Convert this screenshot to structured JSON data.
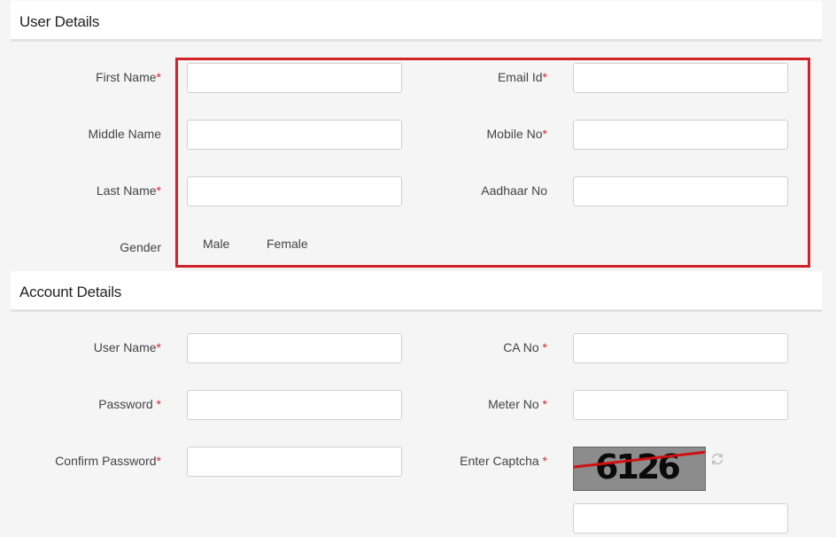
{
  "user_details": {
    "title": "User Details",
    "first_name_label": "First Name",
    "middle_name_label": "Middle Name",
    "last_name_label": "Last Name",
    "gender_label": "Gender",
    "gender_options": [
      "Male",
      "Female"
    ],
    "email_label": "Email Id",
    "mobile_label": "Mobile No",
    "aadhaar_label": "Aadhaar No",
    "first_name_value": "",
    "middle_name_value": "",
    "last_name_value": "",
    "email_value": "",
    "mobile_value": "",
    "aadhaar_value": ""
  },
  "account_details": {
    "title": "Account Details",
    "username_label": "User Name",
    "password_label": "Password ",
    "confirm_password_label": "Confirm Password",
    "ca_no_label": "CA No ",
    "meter_no_label": "Meter No ",
    "captcha_label": "Enter Captcha ",
    "captcha_text": "6126",
    "username_value": "",
    "password_value": "",
    "confirm_password_value": "",
    "ca_no_value": "",
    "meter_no_value": "",
    "captcha_value": ""
  },
  "required_marker": "*",
  "colors": {
    "required": "#d9262e",
    "highlight_border": "#d22228",
    "captcha_bg": "#8c8c8c",
    "captcha_strike": "#d01010"
  },
  "icons": {
    "captcha_refresh": "refresh-icon"
  }
}
